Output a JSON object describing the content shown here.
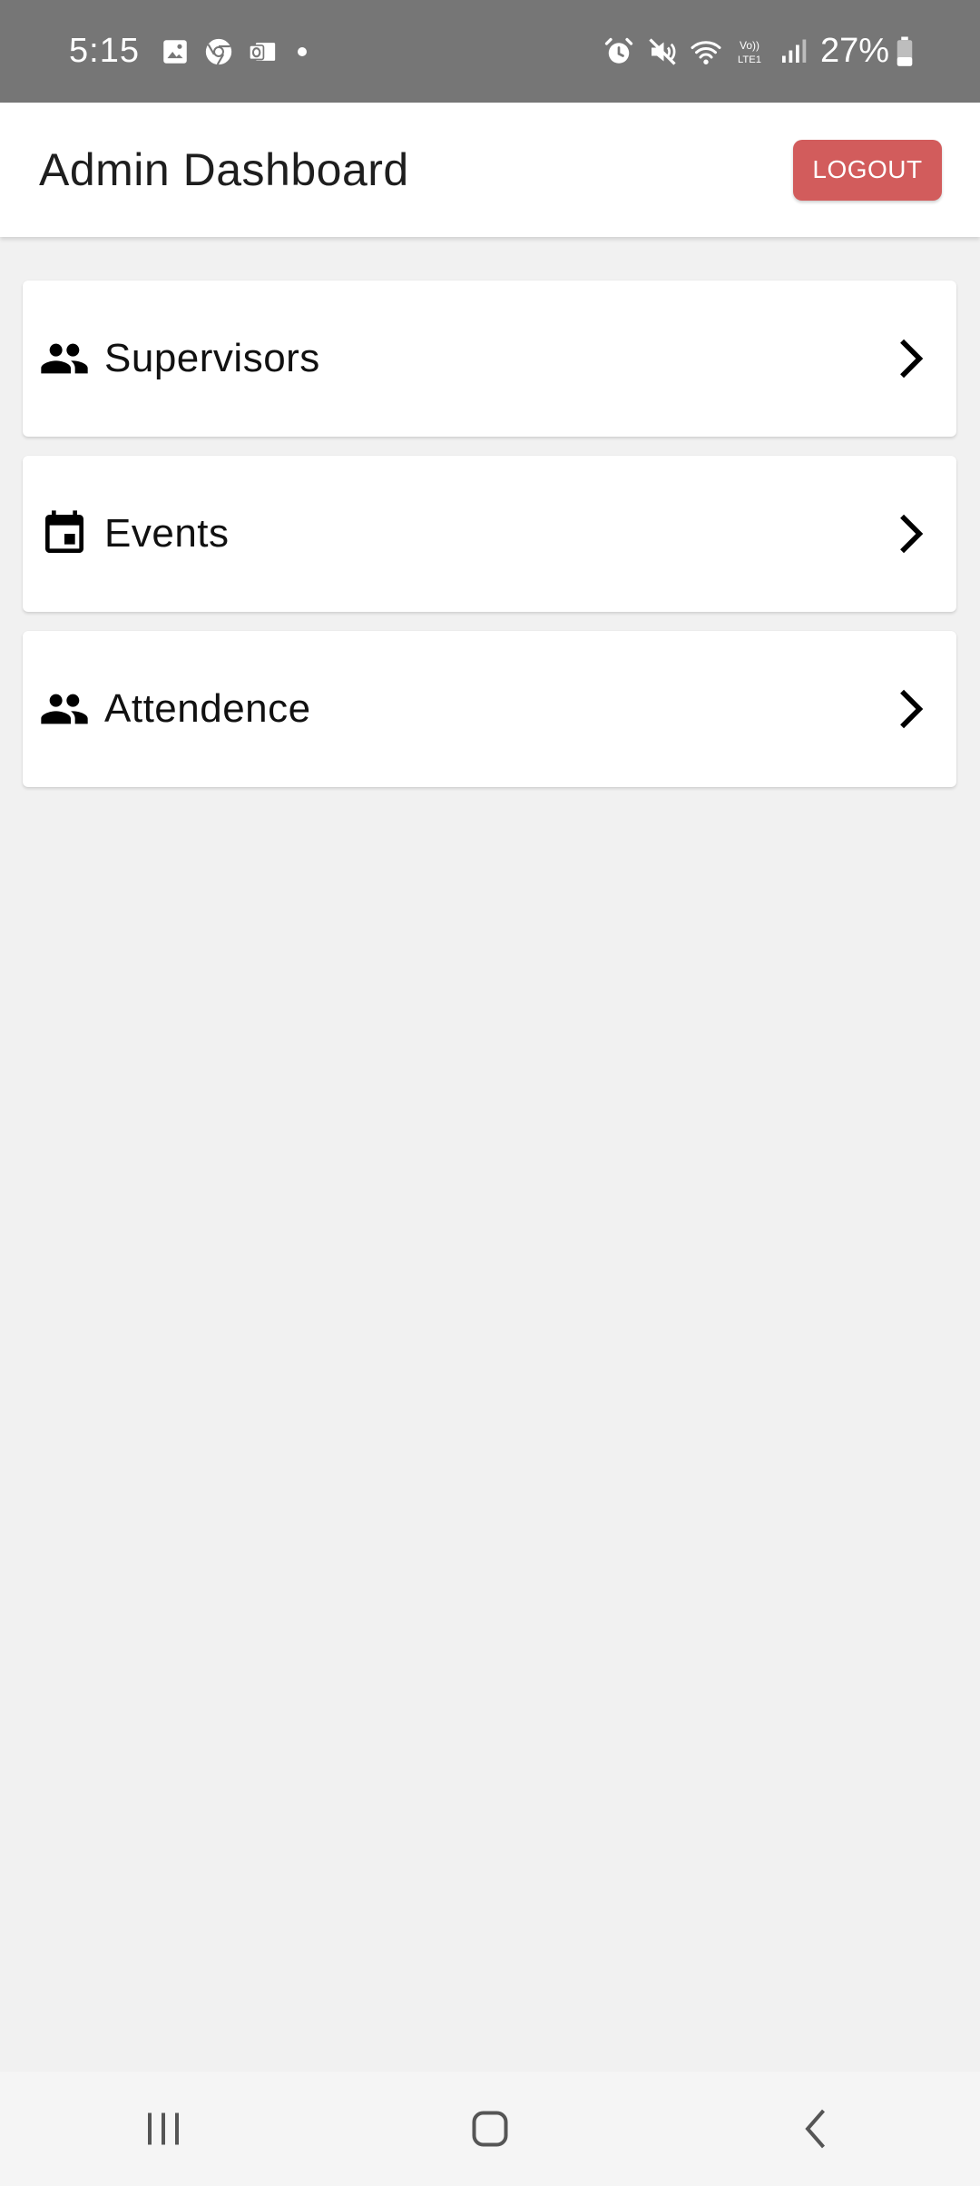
{
  "status_bar": {
    "time": "5:15",
    "battery": "27%",
    "left_icons": [
      "gallery-icon",
      "chrome-icon",
      "outlook-icon"
    ],
    "right_icons": [
      "alarm-icon",
      "mute-icon",
      "wifi-icon",
      "volte-icon",
      "signal-icon",
      "battery-icon"
    ]
  },
  "header": {
    "title": "Admin Dashboard",
    "logout_label": "LOGOUT",
    "logout_color": "#d25c5c"
  },
  "menu": {
    "items": [
      {
        "label": "Supervisors",
        "icon": "people-icon"
      },
      {
        "label": "Events",
        "icon": "calendar-event-icon"
      },
      {
        "label": "Attendence",
        "icon": "people-icon"
      }
    ]
  },
  "nav": {
    "buttons": [
      "recent-apps-icon",
      "home-icon",
      "back-icon"
    ]
  },
  "colors": {
    "status_bar": "#767676",
    "background": "#f1f1f1",
    "accent": "#d25c5c"
  }
}
